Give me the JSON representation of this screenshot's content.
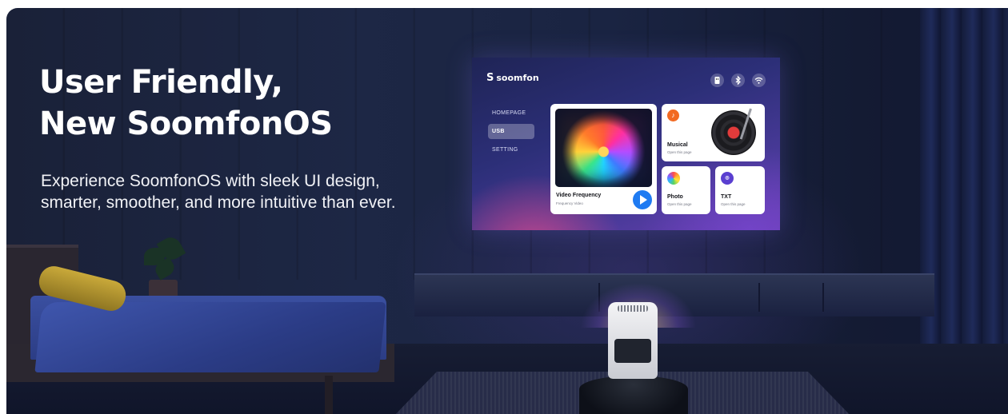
{
  "hero": {
    "title_line1": "User Friendly,",
    "title_line2": "New SoomfonOS",
    "subtitle_line1": "Experience SoomfonOS with sleek UI design,",
    "subtitle_line2": "smarter, smoother, and more intuitive than ever."
  },
  "screen": {
    "brand": "soomfon",
    "brand_mark": "S",
    "status_icons": [
      "usb-drive-icon",
      "bluetooth-icon",
      "wifi-icon"
    ],
    "nav": [
      {
        "label": "HOMEPAGE",
        "active": false
      },
      {
        "label": "USB",
        "active": true
      },
      {
        "label": "SETTING",
        "active": false
      }
    ],
    "cards": {
      "video": {
        "title": "Video Frequency",
        "subtitle": "Frequency Video"
      },
      "music": {
        "title": "Musical",
        "subtitle": "Open this page"
      },
      "photo": {
        "title": "Photo",
        "subtitle": "Open this page"
      },
      "txt": {
        "title": "TXT",
        "subtitle": "Open this page"
      }
    }
  },
  "colors": {
    "accent_blue": "#1f7bf2",
    "music_orange": "#f26a22",
    "txt_purple": "#5a3fd0"
  }
}
